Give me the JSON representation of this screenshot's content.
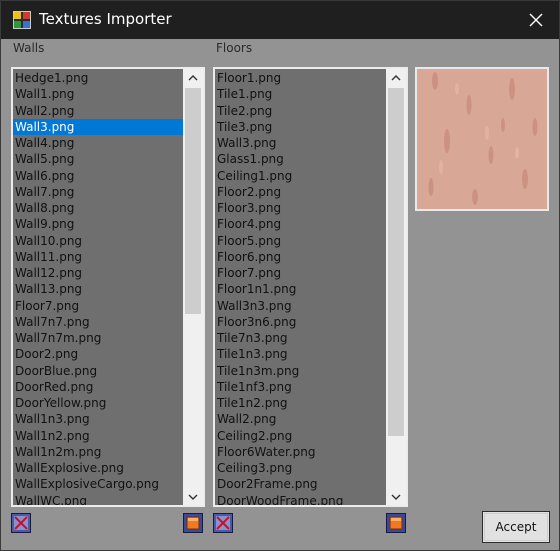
{
  "window": {
    "title": "Textures Importer"
  },
  "walls": {
    "label": "Walls",
    "items": [
      "Hedge1.png",
      "Wall1.png",
      "Wall2.png",
      "Wall3.png",
      "Wall4.png",
      "Wall5.png",
      "Wall6.png",
      "Wall7.png",
      "Wall8.png",
      "Wall9.png",
      "Wall10.png",
      "Wall11.png",
      "Wall12.png",
      "Wall13.png",
      "Floor7.png",
      "Wall7n7.png",
      "Wall7n7m.png",
      "Door2.png",
      "DoorBlue.png",
      "DoorRed.png",
      "DoorYellow.png",
      "Wall1n3.png",
      "Wall1n2.png",
      "Wall1n2m.png",
      "WallExplosive.png",
      "WallExplosiveCargo.png",
      "WallWC.png"
    ],
    "selected_index": 3
  },
  "floors": {
    "label": "Floors",
    "items": [
      "Floor1.png",
      "Tile1.png",
      "Tile2.png",
      "Tile3.png",
      "Wall3.png",
      "Glass1.png",
      "Ceiling1.png",
      "Floor2.png",
      "Floor3.png",
      "Floor4.png",
      "Floor5.png",
      "Floor6.png",
      "Floor7.png",
      "Floor1n1.png",
      "Wall3n3.png",
      "Floor3n6.png",
      "Tile7n3.png",
      "Tile1n3.png",
      "Tile1n3m.png",
      "Tile1nf3.png",
      "Tile1n2.png",
      "Wall2.png",
      "Ceiling2.png",
      "Floor6Water.png",
      "Ceiling3.png",
      "Door2Frame.png",
      "DoorWoodFrame.png"
    ],
    "selected_index": -1
  },
  "accept_button": {
    "label": "Accept"
  },
  "icons": {
    "app": "app-icon",
    "close": "close-icon",
    "remove": "remove-icon",
    "add": "add-icon",
    "up": "chevron-up-icon",
    "down": "chevron-down-icon"
  },
  "colors": {
    "selection": "#0078d7",
    "list_bg": "#6f6f6f",
    "window_bg": "#939393",
    "titlebar": "#1f1f1f",
    "preview_texture": "#d9a898"
  }
}
